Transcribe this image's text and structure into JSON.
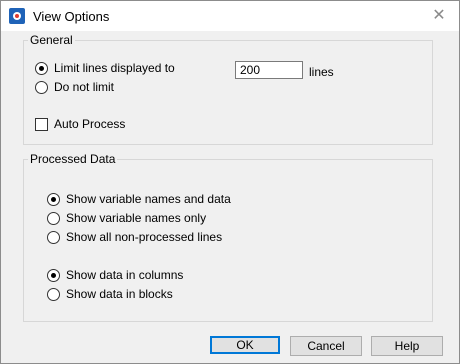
{
  "window": {
    "title": "View Options",
    "app_icon": "app-logo-icon",
    "close_glyph": "✕"
  },
  "general": {
    "legend": "General",
    "options": [
      {
        "label": "Limit lines displayed to",
        "selected": true
      },
      {
        "label": "Do not limit",
        "selected": false
      }
    ],
    "lines_value": "200",
    "lines_unit": "lines",
    "auto_process": {
      "label": "Auto Process",
      "checked": false
    }
  },
  "processed": {
    "legend": "Processed Data",
    "content_options": [
      {
        "label": "Show variable names and data",
        "selected": true
      },
      {
        "label": "Show variable names only",
        "selected": false
      },
      {
        "label": "Show all non-processed lines",
        "selected": false
      }
    ],
    "layout_options": [
      {
        "label": "Show data in columns",
        "selected": true
      },
      {
        "label": "Show data in blocks",
        "selected": false
      }
    ]
  },
  "buttons": {
    "ok": "OK",
    "cancel": "Cancel",
    "help": "Help"
  }
}
